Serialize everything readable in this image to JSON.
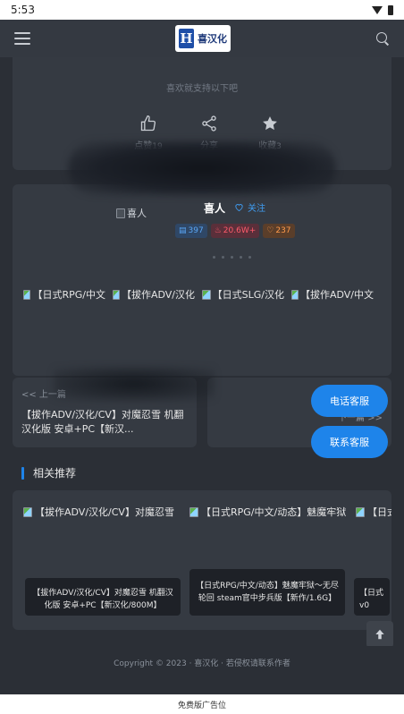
{
  "status_bar": {
    "time": "5:53",
    "icons": [
      "wifi-icon",
      "battery-icon"
    ]
  },
  "header": {
    "logo_text": "喜汉化",
    "logo_mark": "H",
    "icons": [
      "menu-icon",
      "search-icon"
    ]
  },
  "support": {
    "hint": "喜欢就支持以下吧",
    "actions": [
      {
        "icon": "thumbs-up-icon",
        "label": "点赞",
        "count": "19"
      },
      {
        "icon": "share-icon",
        "label": "分享",
        "count": ""
      },
      {
        "icon": "star-icon",
        "label": "收藏",
        "count": "3"
      }
    ]
  },
  "author": {
    "avatar_alt": "喜人",
    "name": "喜人",
    "follow_label": "关注",
    "badges": [
      {
        "icon": "doc-icon",
        "value": "397",
        "color": "#5aa6f5"
      },
      {
        "icon": "fire-icon",
        "value": "20.6W+",
        "color": "#ff5b6b"
      },
      {
        "icon": "like-icon",
        "value": "237",
        "color": "#ff9a4a"
      }
    ],
    "posts": [
      "【日式RPG/中文",
      "【拔作ADV/汉化",
      "【日式SLG/汉化",
      "【拔作ADV/中文"
    ]
  },
  "navigation": {
    "prev_label": "<< 上一篇",
    "prev_title": "【拔作ADV/汉化/CV】对魔忍雪 机翻汉化版 安卓+PC【新汉...",
    "next_title": "下一篇 >>"
  },
  "floating": {
    "phone_service": "电话客服",
    "contact_service": "联系客服"
  },
  "related": {
    "title": "相关推荐",
    "links": [
      "【拔作ADV/汉化/CV】对魔忍雪",
      "【日式RPG/中文/动态】魅魔牢狱",
      "【日式"
    ],
    "items": [
      "【拔作ADV/汉化/CV】对魔忍雪 机翻汉化版 安卓+PC【新汉化/800M】",
      "【日式RPG/中文/动态】魅魔牢狱～无尽轮回 steam官中步兵版【新作/1.6G】",
      "【日式 v0"
    ]
  },
  "footer": {
    "copyright": "Copyright © 2023 · 喜汉化 · 若侵权请联系作者"
  },
  "ad_bar": {
    "label": "免费版广告位"
  },
  "colors": {
    "accent": "#1e84ea",
    "background": "#2b2f36",
    "card": "#353a42"
  }
}
